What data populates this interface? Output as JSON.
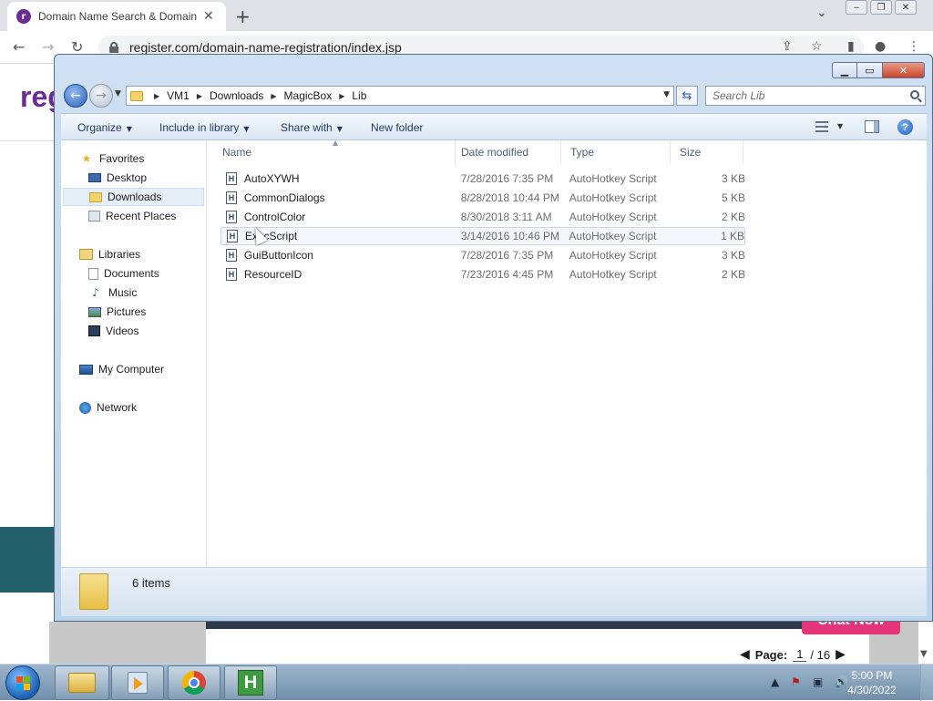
{
  "browser": {
    "tab_title": "Domain Name Search & Domain",
    "tab_favicon_letter": "r",
    "tab_close": "✕",
    "new_tab": "+",
    "url": "register.com/domain-name-registration/index.jsp"
  },
  "webpage": {
    "logo_text": "reg",
    "chat_label": "Chat Now",
    "pager": {
      "label": "Page:",
      "current": "1",
      "separator": "/",
      "total": "16"
    }
  },
  "explorer": {
    "breadcrumb": [
      "VM1",
      "Downloads",
      "MagicBox",
      "Lib"
    ],
    "search_placeholder": "Search Lib",
    "commands": {
      "organize": "Organize",
      "include_in_library": "Include in library",
      "share_with": "Share with",
      "new_folder": "New folder"
    },
    "nav": {
      "favorites": "Favorites",
      "desktop": "Desktop",
      "downloads": "Downloads",
      "recent_places": "Recent Places",
      "libraries": "Libraries",
      "documents": "Documents",
      "music": "Music",
      "pictures": "Pictures",
      "videos": "Videos",
      "my_computer": "My Computer",
      "network": "Network"
    },
    "columns": {
      "name": "Name",
      "date_modified": "Date modified",
      "type": "Type",
      "size": "Size"
    },
    "file_icon_letter": "H",
    "files": [
      {
        "name": "AutoXYWH",
        "date": "7/28/2016 7:35 PM",
        "type": "AutoHotkey Script",
        "size": "3 KB"
      },
      {
        "name": "CommonDialogs",
        "date": "8/28/2018 10:44 PM",
        "type": "AutoHotkey Script",
        "size": "5 KB"
      },
      {
        "name": "ControlColor",
        "date": "8/30/2018 3:11 AM",
        "type": "AutoHotkey Script",
        "size": "2 KB"
      },
      {
        "name": "ExecScript",
        "date": "3/14/2016 10:46 PM",
        "type": "AutoHotkey Script",
        "size": "1 KB"
      },
      {
        "name": "GuiButtonIcon",
        "date": "7/28/2016 7:35 PM",
        "type": "AutoHotkey Script",
        "size": "3 KB"
      },
      {
        "name": "ResourceID",
        "date": "7/23/2016 4:45 PM",
        "type": "AutoHotkey Script",
        "size": "2 KB"
      }
    ],
    "item_count": "6 items"
  },
  "taskbar": {
    "ahk_letter": "H",
    "time": "5:00 PM",
    "date": "4/30/2022"
  },
  "colors": {
    "brand_purple": "#6a2c91",
    "chat_pink": "#e4357a",
    "close_red": "#c8452b"
  }
}
